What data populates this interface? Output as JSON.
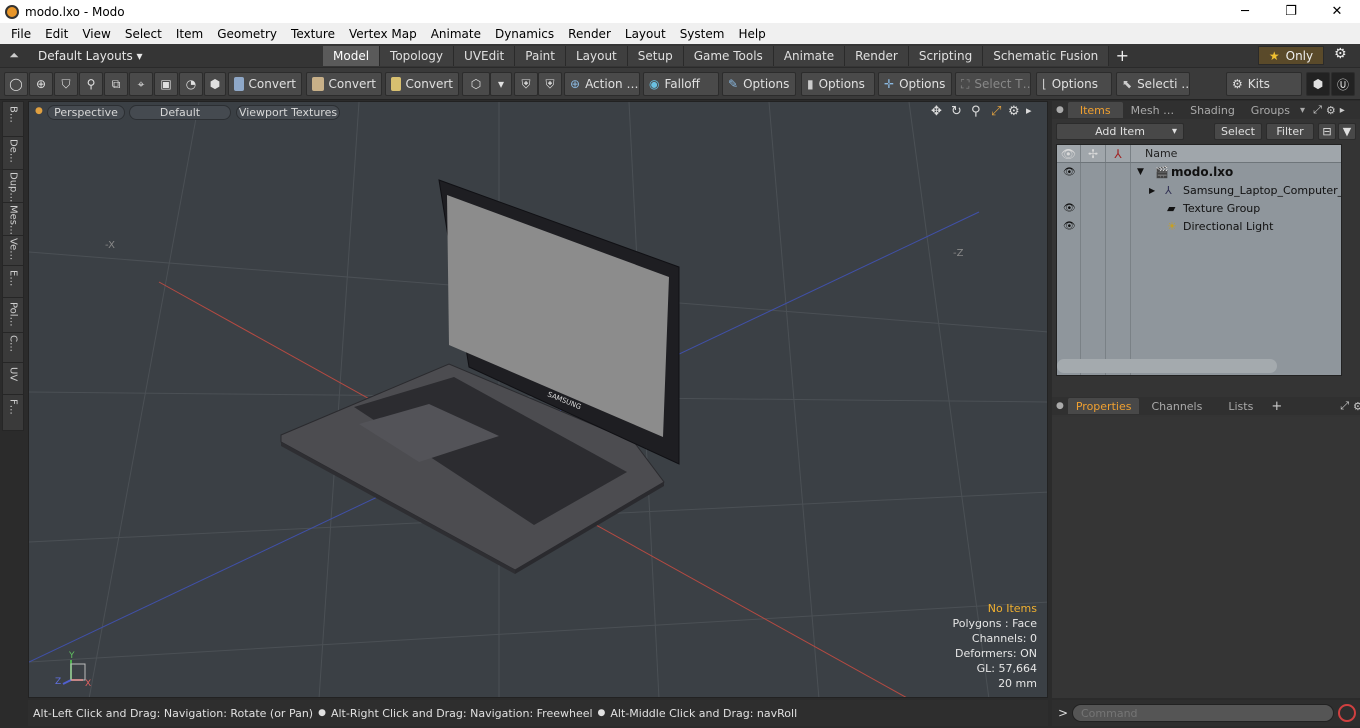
{
  "window": {
    "title": "modo.lxo - Modo"
  },
  "menu": [
    "File",
    "Edit",
    "View",
    "Select",
    "Item",
    "Geometry",
    "Texture",
    "Vertex Map",
    "Animate",
    "Dynamics",
    "Render",
    "Layout",
    "System",
    "Help"
  ],
  "layouts": {
    "preset": "Default Layouts ▾",
    "tabs": [
      "Model",
      "Topology",
      "UVEdit",
      "Paint",
      "Layout",
      "Setup",
      "Game Tools",
      "Animate",
      "Render",
      "Scripting",
      "Schematic Fusion"
    ],
    "active": "Model",
    "only_label": "Only"
  },
  "toolbar": {
    "convert1": "Convert",
    "convert2": "Convert",
    "convert3": "Convert",
    "action": "Action …",
    "falloff": "Falloff",
    "options1": "Options",
    "options2": "Options",
    "options3": "Options",
    "select_t": "Select T…",
    "options4": "Options",
    "selecti": "Selecti …",
    "kits": "Kits"
  },
  "left_tabs": [
    "B…",
    "De…",
    "Dup…",
    "Mes…",
    "Ve…",
    "E…",
    "Pol…",
    "C…",
    "UV",
    "F…"
  ],
  "viewport": {
    "mode": "Perspective",
    "shading": "Default",
    "textures": "Viewport Textures",
    "axis_neg_x": "-X",
    "axis_neg_z": "-Z",
    "brand": "SAMSUNG",
    "info": {
      "selection": "No Items",
      "polygons": "Polygons : Face",
      "channels": "Channels: 0",
      "deformers": "Deformers: ON",
      "gl": "GL: 57,664",
      "grid": "20 mm"
    },
    "gizmo": {
      "y": "Y",
      "z": "Z",
      "x": "X"
    }
  },
  "status": {
    "hint1": "Alt-Left Click and Drag: Navigation: Rotate (or Pan)",
    "hint2": "Alt-Right Click and Drag: Navigation: Freewheel",
    "hint3": "Alt-Middle Click and Drag: navRoll"
  },
  "items_panel": {
    "tabs": [
      "Items",
      "Mesh …",
      "Shading",
      "Groups"
    ],
    "active": "Items",
    "add_item": "Add Item",
    "select": "Select",
    "filter": "Filter",
    "name_header": "Name",
    "rows": [
      {
        "label": "modo.lxo"
      },
      {
        "label": "Samsung_Laptop_Computer_ …"
      },
      {
        "label": "Texture Group"
      },
      {
        "label": "Directional Light"
      }
    ]
  },
  "props_panel": {
    "tabs": [
      "Properties",
      "Channels",
      "Lists"
    ],
    "active": "Properties"
  },
  "command": {
    "placeholder": "Command",
    "prompt": ">"
  },
  "colors": {
    "accent": "#f0a030",
    "viewport_bg": "#3b4045",
    "list_bg": "#8f969c"
  }
}
